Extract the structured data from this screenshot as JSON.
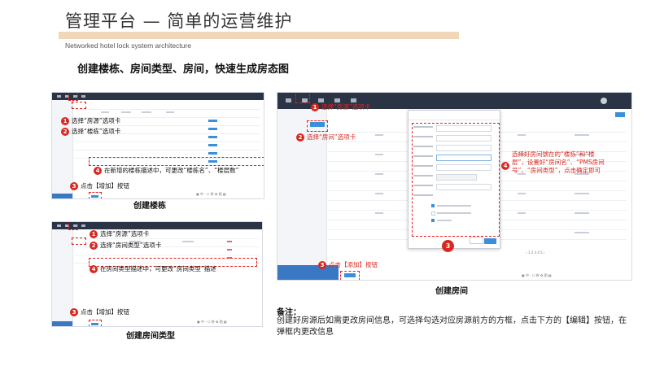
{
  "header": {
    "title": "管理平台 — 简单的运营维护",
    "subtitle": "Networked hotel lock system architecture",
    "heading": "创建楼栋、房间类型、房间，快速生成房态图"
  },
  "panel_building": {
    "caption": "创建楼栋",
    "steps": [
      {
        "num": "1",
        "text": "选择“房源”选项卡"
      },
      {
        "num": "2",
        "text": "选择“楼栋”选项卡"
      },
      {
        "num": "4",
        "text": "在新增的楼栋描述中，可更改“楼栋名”、“楼层数”"
      },
      {
        "num": "3",
        "text": "点击【增加】按钮"
      }
    ]
  },
  "panel_room_type": {
    "caption": "创建房间类型",
    "steps": [
      {
        "num": "1",
        "text": "选择“房源”选项卡"
      },
      {
        "num": "2",
        "text": "选择“房间类型”选项卡"
      },
      {
        "num": "4",
        "text": "在房间类型描述中，可更改“房间类型”描述"
      },
      {
        "num": "3",
        "text": "点击【增加】按钮"
      }
    ]
  },
  "panel_room": {
    "caption": "创建房间",
    "steps": [
      {
        "num": "1",
        "text": "选择“房源”选项卡"
      },
      {
        "num": "2",
        "text": "选择“房间”选项卡"
      },
      {
        "num": "4",
        "text": "选择好房间號在的“楼栋”和“楼层”，设置好“房间名”、“PMS房间号”、“房间类型”，点击确定即可"
      },
      {
        "num": "3",
        "text": "点击【添加】按钮"
      },
      {
        "num": "3",
        "text": ""
      }
    ]
  },
  "note": {
    "label": "备注：",
    "text": "创建好房源后如需更改房间信息，可选择勾选对应房源前方的方框，点击下方的【编辑】按钮，在弹框内更改信息"
  },
  "colors": {
    "accent_red": "#d8281f",
    "title_bar": "#f2d6b8",
    "header_dark": "#2b3445",
    "button_blue": "#3b8fd9"
  }
}
